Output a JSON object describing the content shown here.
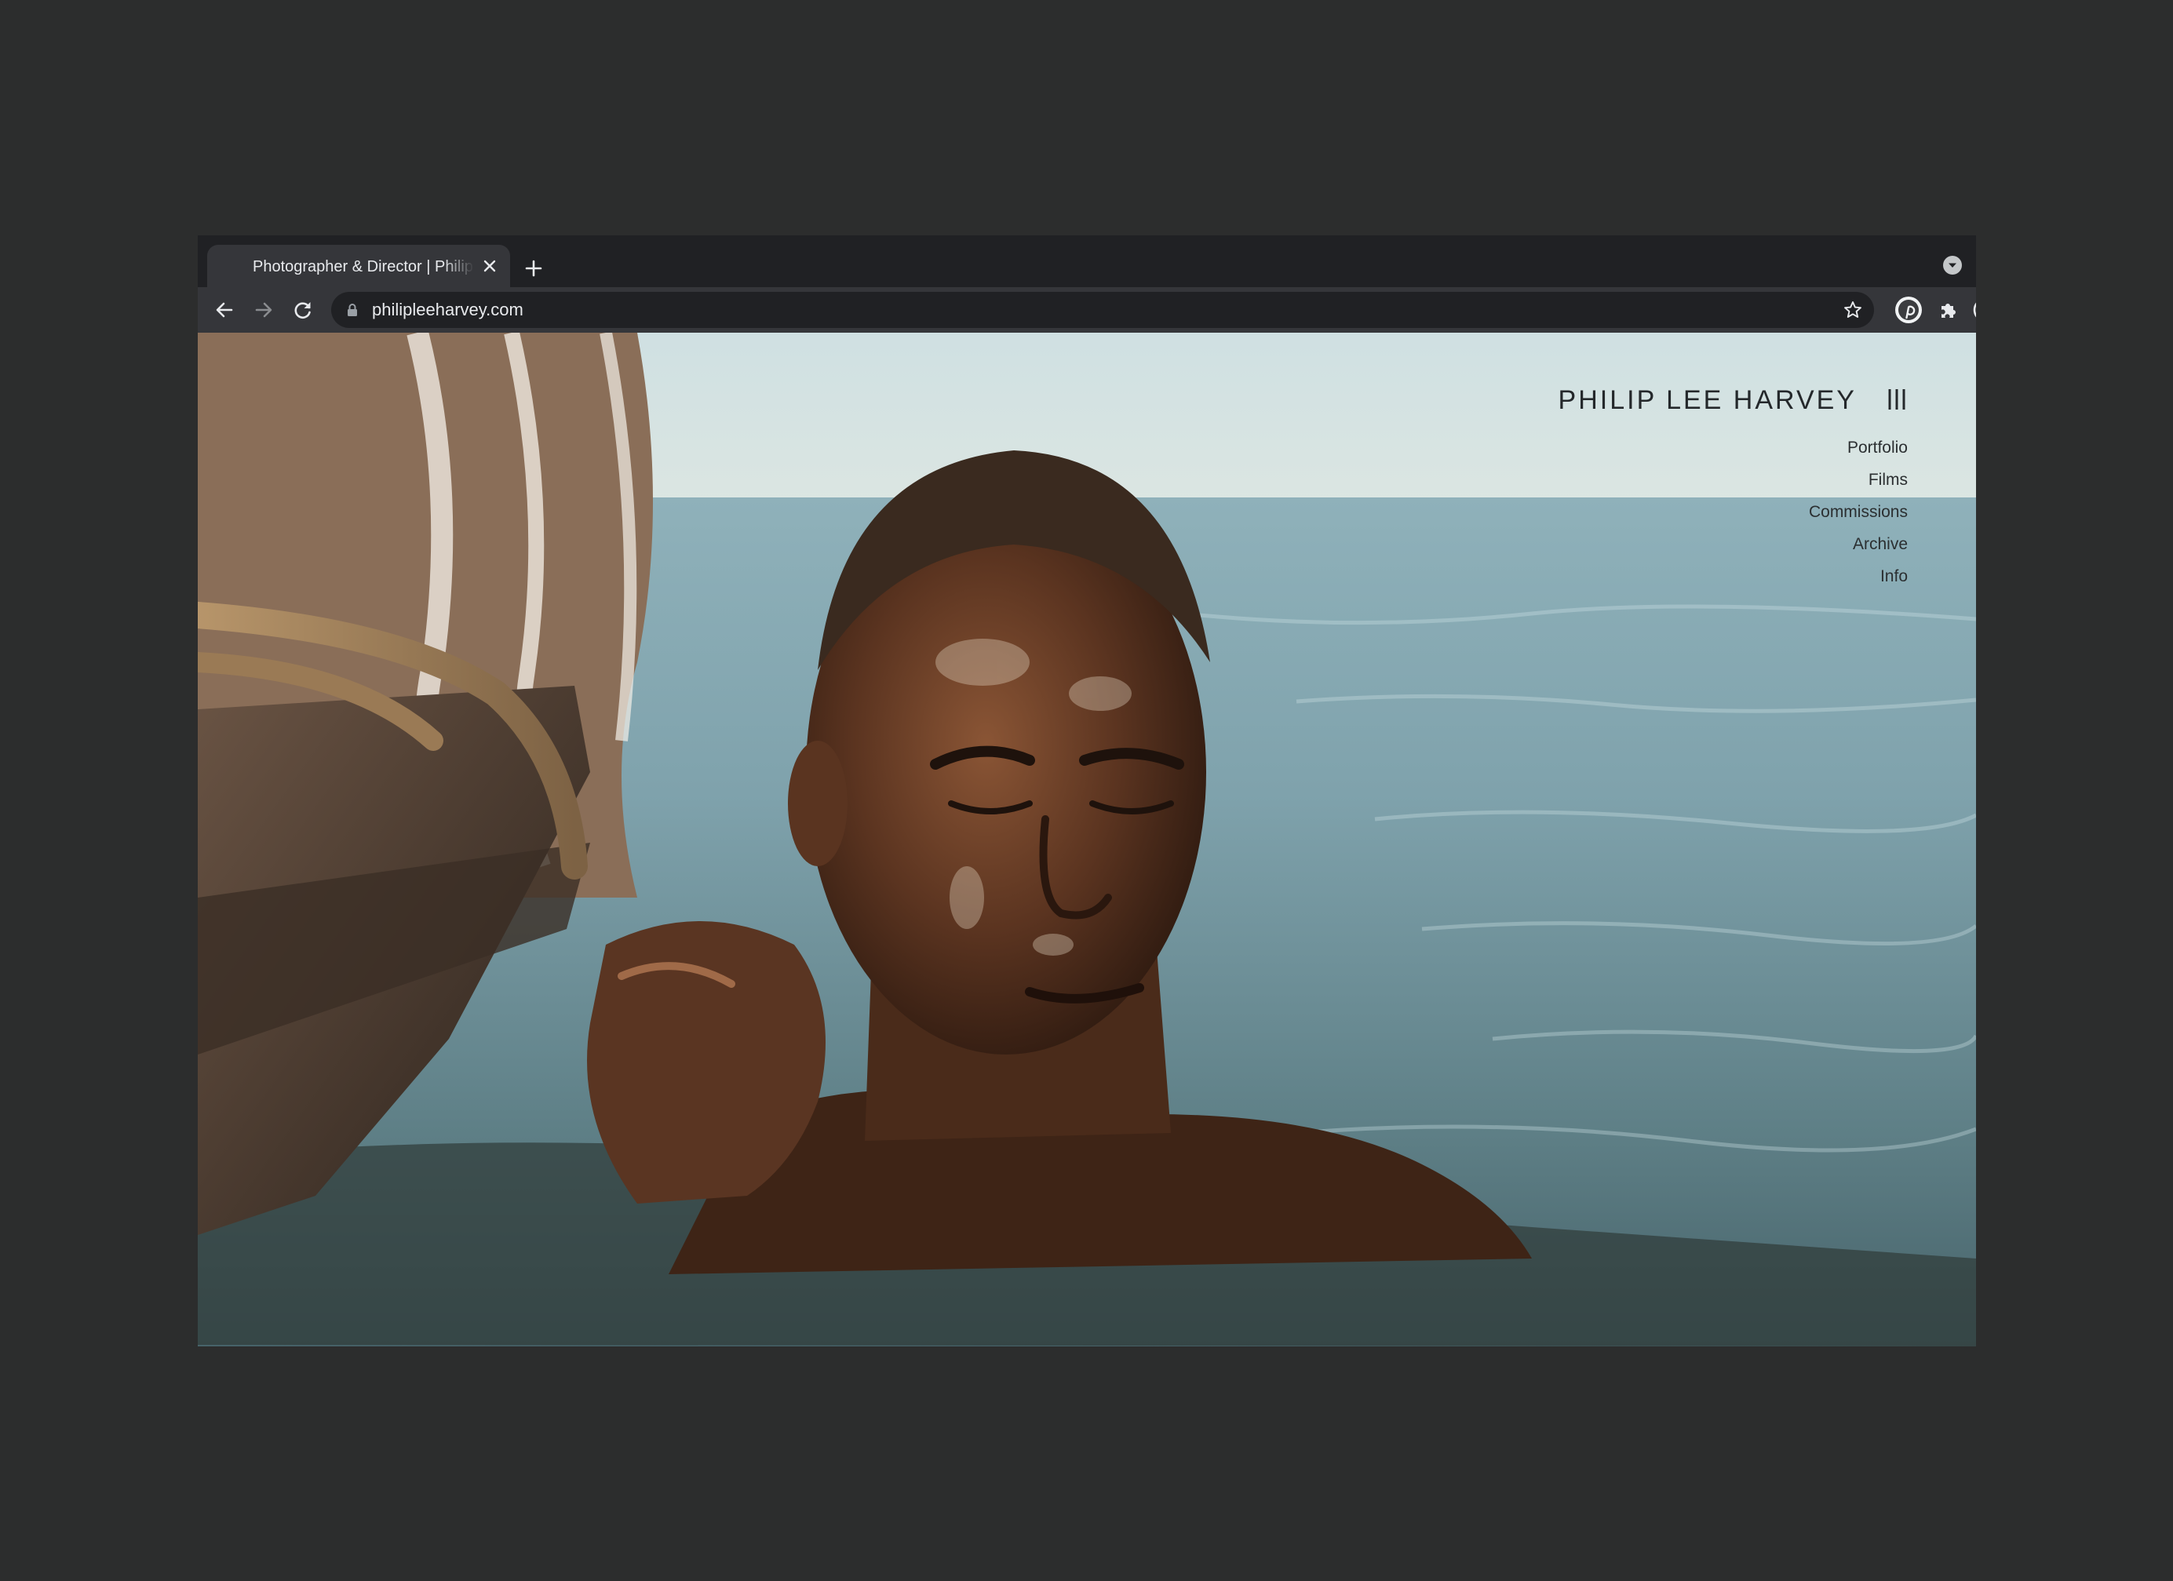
{
  "browser": {
    "tab_title": "Photographer & Director | Philip Lee Harvey",
    "url": "philipleeharvey.com"
  },
  "site": {
    "title": "PHILIP LEE HARVEY",
    "nav": [
      "Portfolio",
      "Films",
      "Commissions",
      "Archive",
      "Info"
    ]
  },
  "icons": {
    "tab_close": "close-icon",
    "new_tab": "plus-icon",
    "tab_search": "chevron-down-circle-icon",
    "back": "arrow-left-icon",
    "forward": "arrow-right-icon",
    "reload": "reload-icon",
    "lock": "lock-icon",
    "bookmark": "star-icon",
    "pinterest": "pinterest-icon",
    "extensions": "puzzle-icon",
    "extension": "circular-extension-icon",
    "menu": "kebab-menu-icon",
    "site_menu": "hamburger-bars-icon"
  },
  "colors": {
    "desktop_background": "#2c2d2d",
    "browser_frame": "#202124",
    "toolbar": "#35363a",
    "site_text": "#24282b"
  }
}
